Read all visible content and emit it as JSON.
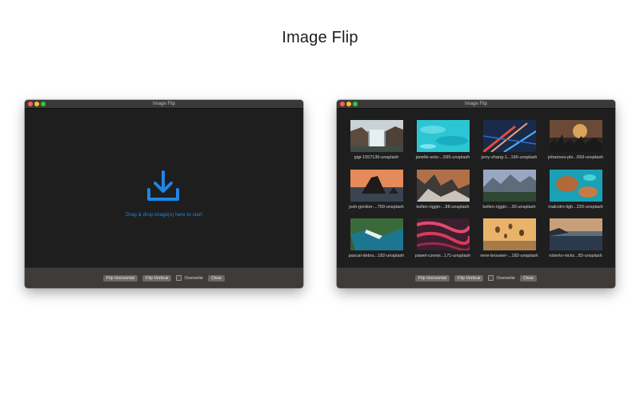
{
  "page": {
    "title": "Image Flip"
  },
  "left_window": {
    "title": "Image Flip",
    "drop_text": "Drag & drop image(s) here to start",
    "accent_color": "#1e86e6",
    "controls": {
      "flip_horizontal": "Flip Horizontal",
      "flip_vertical": "Flip Vertical",
      "overwrite": "Overwrite",
      "clear": "Clear"
    }
  },
  "right_window": {
    "title": "Image Flip",
    "images": [
      {
        "label": "gigi-1557136-unsplash",
        "scene": "waterfall"
      },
      {
        "label": "janelle-soto-...595-unsplash",
        "scene": "aqua water"
      },
      {
        "label": "jerry-zhang-1...196-unsplash",
        "scene": "city lights"
      },
      {
        "label": "johannes-ple...659-unsplash",
        "scene": "city sunset"
      },
      {
        "label": "josh-gordon-...759-unsplash",
        "scene": "sea rock"
      },
      {
        "label": "kellen-riggin-...88-unsplash",
        "scene": "cliffs"
      },
      {
        "label": "kellen-riggin-...30-unsplash",
        "scene": "valley"
      },
      {
        "label": "malcolm-ligh...220-unsplash",
        "scene": "turquoise aerial"
      },
      {
        "label": "pascal-debru...182-unsplash",
        "scene": "coast"
      },
      {
        "label": "pawel-czerwi...171-unsplash",
        "scene": "red landscape"
      },
      {
        "label": "rene-brouwer-...182-unsplash",
        "scene": "balloons"
      },
      {
        "label": "roberto-nicks...83-unsplash",
        "scene": "ocean dusk"
      }
    ],
    "controls": {
      "flip_horizontal": "Flip Horizontal",
      "flip_vertical": "Flip Vertical",
      "overwrite": "Overwrite",
      "clear": "Clear"
    }
  }
}
